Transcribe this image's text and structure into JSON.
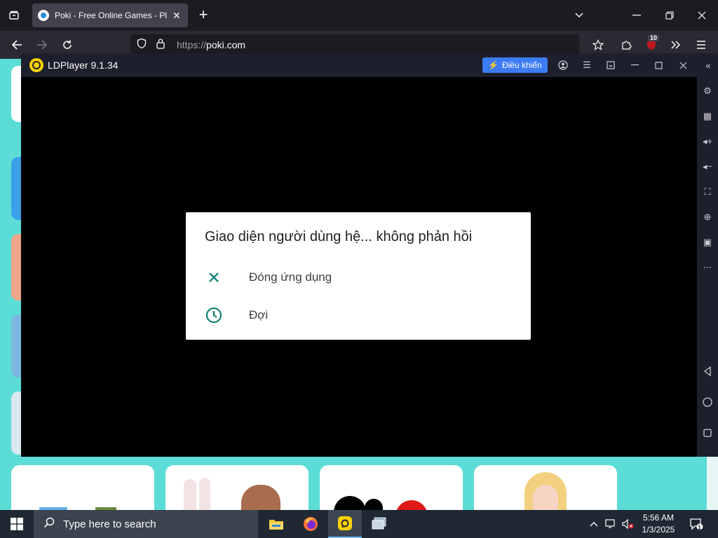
{
  "browser": {
    "tab": {
      "title": "Poki - Free Online Games - Play"
    },
    "url": {
      "scheme": "https://",
      "host": "poki.com"
    },
    "extension_badge": "10"
  },
  "ldplayer": {
    "title": "LDPlayer 9.1.34",
    "control_button": "Điều khiển"
  },
  "dialog": {
    "title": "Giao diện người dùng hệ... không phản hồi",
    "options": [
      {
        "label": "Đóng ứng dụng",
        "icon": "close-icon"
      },
      {
        "label": "Đợi",
        "icon": "clock-icon"
      }
    ]
  },
  "taskbar": {
    "search_placeholder": "Type here to search",
    "time": "5:56 AM",
    "date": "1/3/2025",
    "notification_count": "1"
  },
  "colors": {
    "site_background": "#5cdcd6",
    "dialog_accent": "#00796b",
    "ld_control": "#3d7cf5"
  }
}
